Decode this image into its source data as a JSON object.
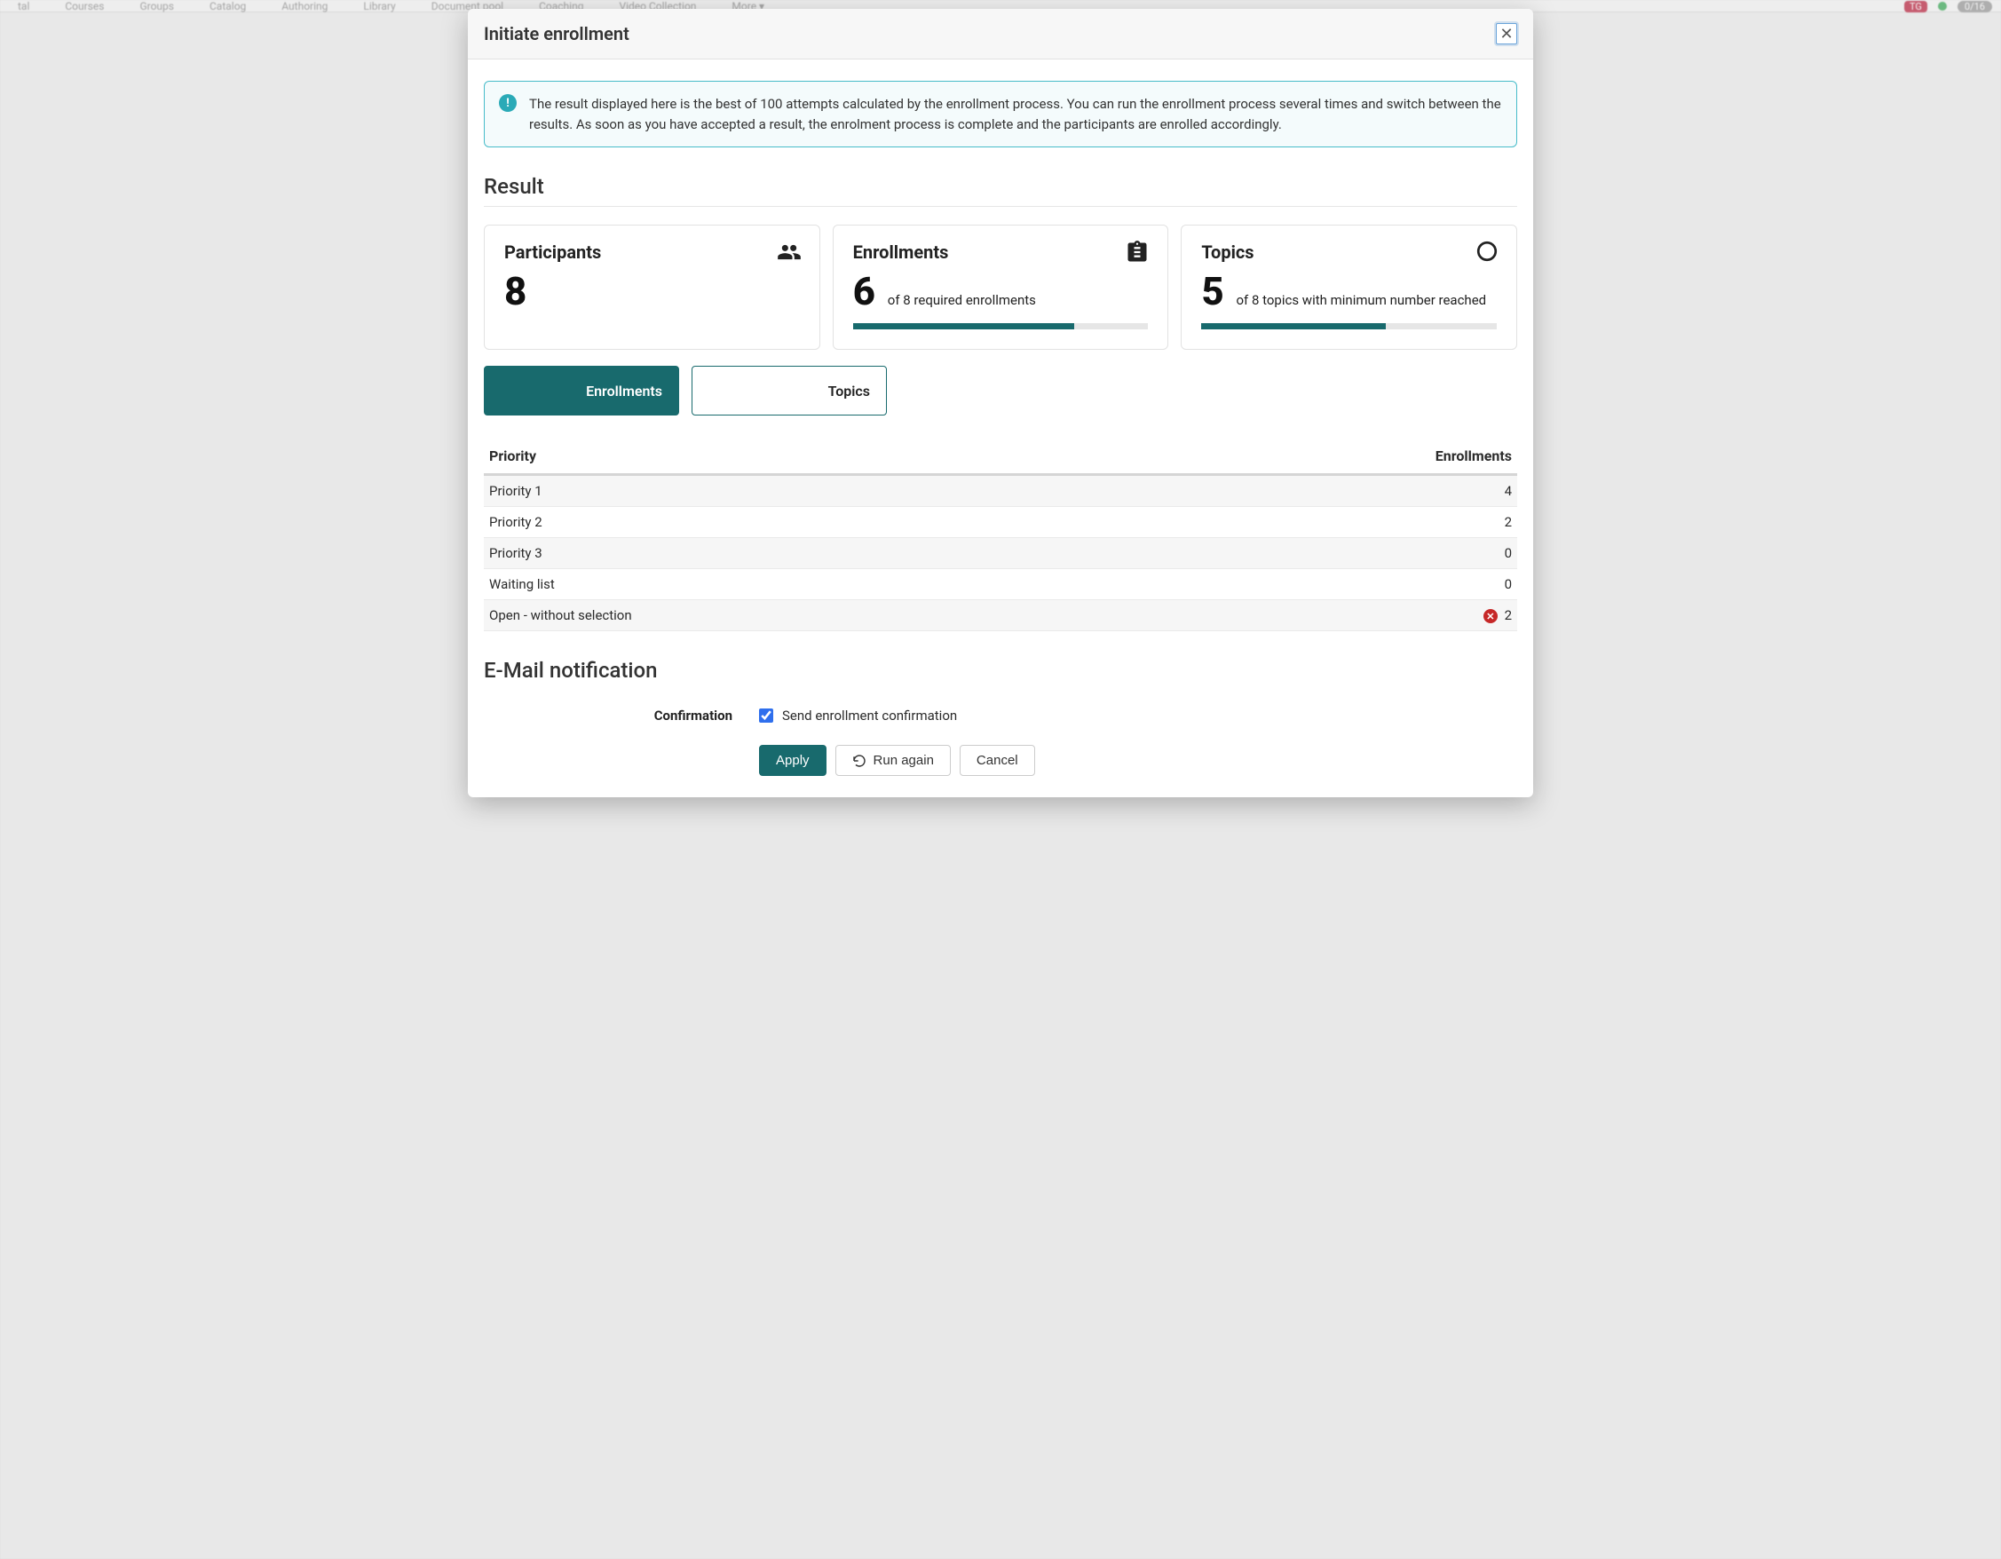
{
  "bg_nav": [
    "Courses",
    "Groups",
    "Catalog",
    "Authoring",
    "Library",
    "Document pool",
    "Coaching",
    "Video Collection",
    "More"
  ],
  "bg_badge_tg": "TG",
  "bg_badge_count": "0/16",
  "modal": {
    "title": "Initiate enrollment",
    "info": "The result displayed here is the best of 100 attempts calculated by the enrollment process. You can run the enrollment process several times and switch between the results. As soon as you have accepted a result, the enrolment process is complete and the participants are enrolled accordingly.",
    "result_heading": "Result",
    "stats": {
      "participants": {
        "title": "Participants",
        "value": "8"
      },
      "enrollments": {
        "title": "Enrollments",
        "value": "6",
        "sub": "of 8 required enrollments",
        "pct": 75
      },
      "topics": {
        "title": "Topics",
        "value": "5",
        "sub": "of 8 topics with minimum number reached",
        "pct": 62.5
      }
    },
    "tabs": {
      "enrollments": "Enrollments",
      "topics": "Topics"
    },
    "table": {
      "col_priority": "Priority",
      "col_enrollments": "Enrollments",
      "rows": [
        {
          "label": "Priority 1",
          "value": "4",
          "warn": false
        },
        {
          "label": "Priority 2",
          "value": "2",
          "warn": false
        },
        {
          "label": "Priority 3",
          "value": "0",
          "warn": false
        },
        {
          "label": "Waiting list",
          "value": "0",
          "warn": false
        },
        {
          "label": "Open - without selection",
          "value": "2",
          "warn": true
        }
      ]
    },
    "email_heading": "E-Mail notification",
    "confirmation_label": "Confirmation",
    "checkbox_label": "Send enrollment confirmation",
    "buttons": {
      "apply": "Apply",
      "run_again": "Run again",
      "cancel": "Cancel"
    }
  }
}
